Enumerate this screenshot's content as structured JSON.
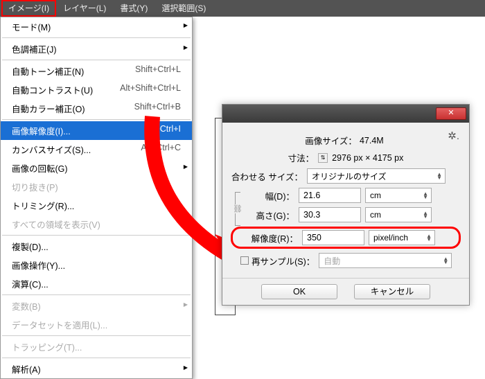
{
  "menubar": {
    "image": "イメージ(I)",
    "layer": "レイヤー(L)",
    "type": "書式(Y)",
    "select": "選択範囲(S)"
  },
  "menu": {
    "mode": "モード(M)",
    "adjust": "色調補正(J)",
    "autotone": "自動トーン補正(N)",
    "autotone_sc": "Shift+Ctrl+L",
    "autocontrast": "自動コントラスト(U)",
    "autocontrast_sc": "Alt+Shift+Ctrl+L",
    "autocolor": "自動カラー補正(O)",
    "autocolor_sc": "Shift+Ctrl+B",
    "imagesize": "画像解像度(I)...",
    "imagesize_sc": "Alt+Ctrl+I",
    "canvassize": "カンバスサイズ(S)...",
    "canvassize_sc": "Alt+Ctrl+C",
    "rotate": "画像の回転(G)",
    "crop": "切り抜き(P)",
    "trim": "トリミング(R)...",
    "reveal": "すべての領域を表示(V)",
    "duplicate": "複製(D)...",
    "apply": "画像操作(Y)...",
    "calc": "演算(C)...",
    "vars": "変数(B)",
    "datasets": "データセットを適用(L)...",
    "trap": "トラッピング(T)...",
    "analysis": "解析(A)"
  },
  "dlg": {
    "sizelabel": "画像サイズ：",
    "sizeval": "47.4M",
    "dimlabel": "寸法：",
    "dimval": "2976 px × 4175 px",
    "fitlabel": "合わせる サイズ：",
    "fitval": "オリジナルのサイズ",
    "widthlabel": "幅(D)：",
    "widthval": "21.6",
    "widthunit": "cm",
    "heightlabel": "高さ(G)：",
    "heightval": "30.3",
    "heightunit": "cm",
    "reslabel": "解像度(R)：",
    "resval": "350",
    "resunit": "pixel/inch",
    "resamplelabel": "再サンプル(S)：",
    "resampleval": "自動",
    "ok": "OK",
    "cancel": "キャンセル"
  }
}
